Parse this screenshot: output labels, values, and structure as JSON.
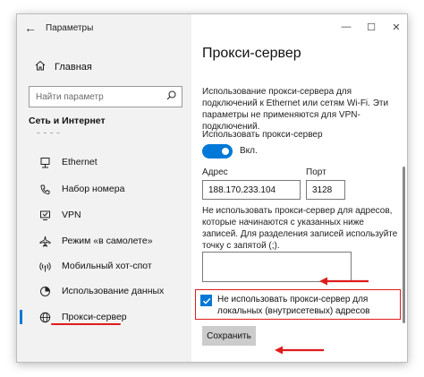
{
  "window": {
    "title": "Параметры"
  },
  "sidebar": {
    "home_label": "Главная",
    "search_placeholder": "Найти параметр",
    "section_title": "Сеть и Интернет",
    "items": [
      {
        "label": "Ethernet",
        "icon": "ethernet-icon",
        "selected": false
      },
      {
        "label": "Набор номера",
        "icon": "dialup-icon",
        "selected": false
      },
      {
        "label": "VPN",
        "icon": "vpn-icon",
        "selected": false
      },
      {
        "label": "Режим «в самолете»",
        "icon": "airplane-icon",
        "selected": false
      },
      {
        "label": "Мобильный хот-спот",
        "icon": "hotspot-icon",
        "selected": false
      },
      {
        "label": "Использование данных",
        "icon": "data-usage-icon",
        "selected": false
      },
      {
        "label": "Прокси-сервер",
        "icon": "globe-icon",
        "selected": true
      }
    ]
  },
  "content": {
    "page_title": "Прокси-сервер",
    "description": "Использование прокси-сервера для подключений к Ethernet или сетям Wi-Fi. Эти параметры не применяются для VPN-подключений.",
    "use_proxy_label": "Использовать прокси-сервер",
    "toggle_state": "Вкл.",
    "address_label": "Адрес",
    "address_value": "188.170.233.104",
    "port_label": "Порт",
    "port_value": "3128",
    "exceptions_description": "Не использовать прокси-сервер для адресов, которые начинаются с указанных ниже записей. Для разделения записей используйте точку с запятой (;).",
    "exceptions_value": "",
    "local_checkbox_label": "Не использовать прокси-сервер для локальных (внутрисетевых) адресов",
    "local_checkbox_checked": true,
    "save_label": "Сохранить"
  },
  "colors": {
    "accent": "#0078d7",
    "annotation": "#e01b1b"
  }
}
